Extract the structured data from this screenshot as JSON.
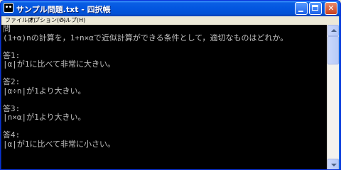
{
  "window": {
    "title": "サンプル問題.txt - 四択帳"
  },
  "menu": {
    "items": [
      {
        "label": "ファイル(F)"
      },
      {
        "label": "オプション(O)"
      },
      {
        "label": "ヘルプ(H)"
      }
    ]
  },
  "console": {
    "lines": [
      "問",
      "(1+α)nの計算を，1+n×αで近似計算ができる条件として，適切なものはどれか。",
      "",
      "答1:",
      "|α|が1に比べて非常に大きい。",
      "",
      "答2:",
      "|α÷n|が1より大きい。",
      "",
      "答3:",
      "|n×α|が1より大きい。",
      "",
      "答4:",
      "|α|が1に比べて非常に小さい。"
    ]
  },
  "icons": {
    "app": "console-cat-icon",
    "minimize": "minimize-icon",
    "maximize": "maximize-icon",
    "close": "close-icon"
  },
  "colors": {
    "titlebar": "#0356e0",
    "console_bg": "#000000",
    "console_text": "#c0c0c0"
  }
}
